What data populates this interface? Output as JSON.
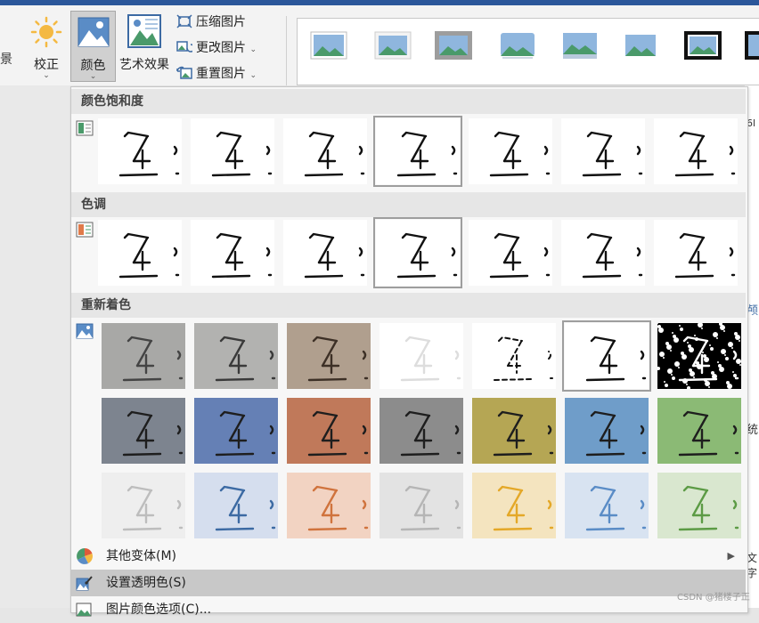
{
  "ribbon": {
    "partial_label": "景",
    "correct": {
      "label": "校正",
      "chevron": "⌄"
    },
    "color": {
      "label": "颜色",
      "chevron": "⌄"
    },
    "art_effects": {
      "label": "艺术效果",
      "chevron": "⌄"
    },
    "compress": {
      "label": "压缩图片"
    },
    "change": {
      "label": "更改图片",
      "chevron": "⌄"
    },
    "reset": {
      "label": "重置图片",
      "chevron": "⌄"
    }
  },
  "color_menu": {
    "sections": {
      "saturation": "颜色饱和度",
      "tone": "色调",
      "recolor": "重新着色"
    },
    "items": {
      "more_variations": "其他变体(M)",
      "set_transparent": "设置透明色(S)",
      "picture_color_options": "图片颜色选项(C)..."
    }
  },
  "page_edge": {
    "t1": "6l",
    "t2": "颅",
    "t3": "统",
    "t4": "文字"
  },
  "watermark": "CSDN @猪楼子正",
  "colors": {
    "accent": "#2b579a",
    "recolor_dark": [
      "#7d848f",
      "#6580b5",
      "#c0795a",
      "#8c8c8c",
      "#b5a654",
      "#6f9dc9",
      "#8bba75"
    ],
    "recolor_light": [
      "#eeeeee",
      "#d5deee",
      "#f2d3c2",
      "#e3e3e3",
      "#f4e4bf",
      "#d8e3f1",
      "#d9e7cf"
    ]
  }
}
